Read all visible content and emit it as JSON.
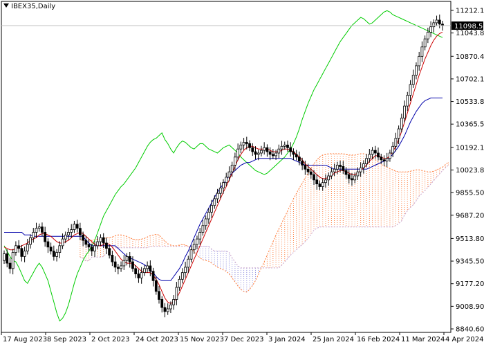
{
  "chart_data": {
    "type": "candlestick",
    "symbol_label": "IBEX35,Daily",
    "current_price_label": "11098.50",
    "y_ticks": [
      "11212.10",
      "11043.80",
      "10870.40",
      "10702.10",
      "10533.80",
      "10365.50",
      "10192.10",
      "10023.80",
      "9855.50",
      "9687.20",
      "9513.80",
      "9345.50",
      "9177.20",
      "9008.90",
      "8840.60"
    ],
    "x_labels": [
      "17 Aug 2023",
      "8 Sep 2023",
      "2 Oct 2023",
      "24 Oct 2023",
      "15 Nov 2023",
      "7 Dec 2023",
      "3 Jan 2024",
      "25 Jan 2024",
      "16 Feb 2024",
      "11 Mar 2024",
      "4 Apr 2024"
    ],
    "ylim": [
      8840.6,
      11212.1
    ],
    "grid": false,
    "colors": {
      "tenkan": "#cc0000",
      "kijun": "#0000aa",
      "chikou": "#00cc00",
      "senkou_a": "#ff7f3f",
      "senkou_b": "#c8a0c8",
      "bull_cloud": "#ff7f3f",
      "bear_cloud": "#8888dd",
      "candle": "#000000",
      "price_line": "#c0c0c0"
    },
    "candles_close": [
      9400,
      9330,
      9290,
      9410,
      9460,
      9440,
      9380,
      9420,
      9470,
      9520,
      9560,
      9590,
      9600,
      9560,
      9490,
      9450,
      9420,
      9380,
      9410,
      9460,
      9510,
      9540,
      9560,
      9580,
      9620,
      9590,
      9540,
      9500,
      9470,
      9450,
      9420,
      9460,
      9490,
      9520,
      9480,
      9440,
      9390,
      9340,
      9300,
      9290,
      9310,
      9350,
      9380,
      9340,
      9290,
      9250,
      9220,
      9260,
      9290,
      9310,
      9270,
      9200,
      9120,
      9060,
      9000,
      8970,
      8990,
      9020,
      9060,
      9150,
      9210,
      9260,
      9300,
      9360,
      9430,
      9470,
      9510,
      9560,
      9610,
      9660,
      9710,
      9760,
      9810,
      9850,
      9890,
      9930,
      9970,
      10010,
      10060,
      10120,
      10180,
      10210,
      10230,
      10220,
      10190,
      10160,
      10140,
      10150,
      10170,
      10190,
      10160,
      10140,
      10130,
      10150,
      10180,
      10200,
      10210,
      10190,
      10160,
      10140,
      10120,
      10090,
      10060,
      10030,
      10010,
      9990,
      9950,
      9920,
      9900,
      9930,
      9950,
      9980,
      10010,
      10030,
      10060,
      10050,
      10020,
      9990,
      9960,
      9950,
      9980,
      10010,
      10040,
      10070,
      10110,
      10140,
      10170,
      10150,
      10120,
      10100,
      10090,
      10110,
      10150,
      10200,
      10260,
      10330,
      10410,
      10500,
      10580,
      10660,
      10730,
      10800,
      10870,
      10940,
      11000,
      11050,
      11090,
      11120,
      11140,
      11110,
      11098.5
    ],
    "candles_open": [
      9350,
      9400,
      9330,
      9290,
      9410,
      9460,
      9440,
      9380,
      9420,
      9470,
      9520,
      9560,
      9590,
      9600,
      9560,
      9490,
      9450,
      9420,
      9380,
      9410,
      9460,
      9510,
      9540,
      9560,
      9580,
      9620,
      9590,
      9540,
      9500,
      9470,
      9450,
      9420,
      9460,
      9490,
      9520,
      9480,
      9440,
      9390,
      9340,
      9300,
      9290,
      9310,
      9350,
      9380,
      9340,
      9290,
      9250,
      9220,
      9260,
      9290,
      9310,
      9270,
      9200,
      9120,
      9060,
      9000,
      8970,
      8990,
      9020,
      9060,
      9150,
      9210,
      9260,
      9300,
      9360,
      9430,
      9470,
      9510,
      9560,
      9610,
      9660,
      9710,
      9760,
      9810,
      9850,
      9890,
      9930,
      9970,
      10010,
      10060,
      10120,
      10180,
      10210,
      10230,
      10220,
      10190,
      10160,
      10140,
      10150,
      10170,
      10190,
      10160,
      10140,
      10130,
      10150,
      10180,
      10200,
      10210,
      10190,
      10160,
      10140,
      10120,
      10090,
      10060,
      10030,
      10010,
      9990,
      9950,
      9920,
      9900,
      9930,
      9950,
      9980,
      10010,
      10030,
      10060,
      10050,
      10020,
      9990,
      9960,
      9950,
      9980,
      10010,
      10040,
      10070,
      10110,
      10140,
      10170,
      10150,
      10120,
      10100,
      10090,
      10110,
      10150,
      10200,
      10260,
      10330,
      10410,
      10500,
      10580,
      10660,
      10730,
      10800,
      10870,
      10940,
      11000,
      11050,
      11090,
      11120,
      11140,
      11110
    ],
    "tenkan": [
      9450,
      9440,
      9430,
      9430,
      9440,
      9450,
      9460,
      9470,
      9480,
      9500,
      9510,
      9520,
      9540,
      9550,
      9550,
      9540,
      9530,
      9510,
      9490,
      9480,
      9480,
      9490,
      9500,
      9520,
      9540,
      9550,
      9560,
      9550,
      9530,
      9510,
      9490,
      9470,
      9460,
      9460,
      9470,
      9480,
      9470,
      9450,
      9420,
      9390,
      9360,
      9340,
      9330,
      9330,
      9330,
      9310,
      9290,
      9270,
      9260,
      9260,
      9260,
      9240,
      9210,
      9170,
      9120,
      9070,
      9040,
      9030,
      9040,
      9070,
      9110,
      9160,
      9210,
      9260,
      9310,
      9360,
      9410,
      9460,
      9510,
      9560,
      9610,
      9660,
      9710,
      9760,
      9810,
      9860,
      9900,
      9950,
      10000,
      10050,
      10100,
      10140,
      10170,
      10190,
      10200,
      10200,
      10190,
      10180,
      10180,
      10180,
      10180,
      10170,
      10160,
      10160,
      10160,
      10170,
      10180,
      10180,
      10170,
      10160,
      10140,
      10120,
      10100,
      10070,
      10050,
      10030,
      10010,
      9990,
      9970,
      9960,
      9960,
      9970,
      9980,
      10000,
      10010,
      10020,
      10020,
      10010,
      10000,
      9990,
      9990,
      10000,
      10020,
      10040,
      10060,
      10090,
      10110,
      10130,
      10130,
      10120,
      10110,
      10110,
      10130,
      10160,
      10200,
      10250,
      10310,
      10380,
      10450,
      10520,
      10590,
      10660,
      10730,
      10790,
      10850,
      10900,
      10950,
      10990,
      11020,
      11040,
      11050
    ],
    "kijun": [
      9560,
      9560,
      9560,
      9560,
      9560,
      9560,
      9560,
      9540,
      9540,
      9540,
      9530,
      9530,
      9530,
      9530,
      9530,
      9530,
      9530,
      9530,
      9530,
      9530,
      9530,
      9530,
      9530,
      9530,
      9530,
      9530,
      9530,
      9530,
      9500,
      9480,
      9460,
      9460,
      9460,
      9460,
      9460,
      9460,
      9460,
      9460,
      9460,
      9440,
      9420,
      9400,
      9380,
      9370,
      9360,
      9350,
      9340,
      9330,
      9320,
      9300,
      9280,
      9260,
      9230,
      9210,
      9200,
      9200,
      9200,
      9200,
      9230,
      9260,
      9290,
      9330,
      9380,
      9420,
      9470,
      9520,
      9570,
      9620,
      9660,
      9700,
      9740,
      9780,
      9820,
      9860,
      9890,
      9920,
      9950,
      9980,
      10000,
      10020,
      10040,
      10060,
      10070,
      10080,
      10080,
      10090,
      10100,
      10110,
      10110,
      10110,
      10110,
      10110,
      10110,
      10110,
      10110,
      10110,
      10110,
      10110,
      10110,
      10100,
      10090,
      10080,
      10070,
      10060,
      10060,
      10060,
      10060,
      10060,
      10060,
      10060,
      10060,
      10050,
      10040,
      10030,
      10030,
      10030,
      10030,
      10030,
      10030,
      10030,
      10030,
      10030,
      10030,
      10030,
      10030,
      10040,
      10050,
      10060,
      10070,
      10080,
      10090,
      10100,
      10120,
      10140,
      10170,
      10200,
      10240,
      10280,
      10330,
      10380,
      10420,
      10460,
      10490,
      10520,
      10540,
      10550,
      10560,
      10560,
      10560,
      10560,
      10560
    ],
    "chikou": [
      9460,
      9420,
      9380,
      9350,
      9340,
      9300,
      9250,
      9200,
      9180,
      9220,
      9260,
      9300,
      9330,
      9300,
      9250,
      9200,
      9120,
      9040,
      8960,
      8900,
      8920,
      8960,
      9020,
      9100,
      9180,
      9250,
      9300,
      9350,
      9390,
      9420,
      9460,
      9500,
      9560,
      9620,
      9680,
      9720,
      9760,
      9800,
      9840,
      9870,
      9900,
      9920,
      9950,
      9980,
      10010,
      10040,
      10080,
      10120,
      10160,
      10200,
      10230,
      10250,
      10260,
      10280,
      10300,
      10250,
      10220,
      10180,
      10150,
      10190,
      10220,
      10240,
      10230,
      10210,
      10190,
      10180,
      10200,
      10220,
      10220,
      10200,
      10180,
      10170,
      10160,
      10150,
      10170,
      10190,
      10200,
      10210,
      10190,
      10170,
      10150,
      10120,
      10100,
      10080,
      10060,
      10040,
      10020,
      10010,
      10000,
      9990,
      10000,
      10020,
      10040,
      10060,
      10080,
      10100,
      10120,
      10150,
      10180,
      10220,
      10270,
      10330,
      10400,
      10460,
      10520,
      10570,
      10620,
      10660,
      10700,
      10740,
      10780,
      10820,
      10860,
      10900,
      10940,
      10980,
      11010,
      11040,
      11070,
      11100,
      11120,
      11140,
      11160,
      11150,
      11130,
      11110,
      11120,
      11140,
      11160,
      11180,
      11200,
      11210,
      11200,
      11180,
      11170,
      11160,
      11150,
      11140,
      11130,
      11120,
      11110,
      11100,
      11090,
      11080,
      11070,
      11060,
      11050,
      11040,
      11030,
      11020,
      11010
    ]
  }
}
